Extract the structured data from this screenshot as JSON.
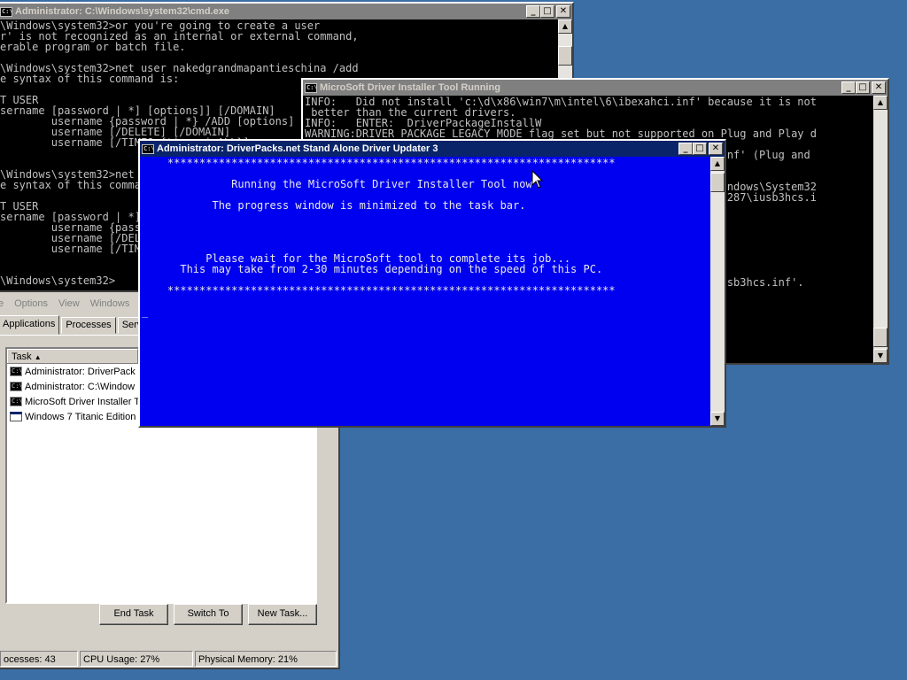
{
  "cmd_window": {
    "title": "Administrator: C:\\Windows\\system32\\cmd.exe",
    "lines": [
      "\\Windows\\system32>or you're going to create a user",
      "r' is not recognized as an internal or external command,",
      "erable program or batch file.",
      "",
      "\\Windows\\system32>net user nakedgrandmapantieschina /add",
      "e syntax of this command is:",
      "",
      "T USER",
      "sername [password | *] [options]] [/DOMAIN]",
      "        username {password | *} /ADD [options] [/DOMAIN]",
      "        username [/DELETE] [/DOMAIN]",
      "        username [/TIMES:{times | ALL}]",
      "",
      "",
      "\\Windows\\system32>net user",
      "e syntax of this command is:",
      "",
      "T USER",
      "sername [password | *] [options]] [/DOMAIN]",
      "        username {password | *} /ADD [options] [/DOMAIN]",
      "        username [/DELETE] [/DOMAIN]",
      "        username [/TIMES:{times | ALL}]",
      "",
      "",
      "\\Windows\\system32>"
    ]
  },
  "installer_window": {
    "title": "MicroSoft Driver Installer Tool Running",
    "lines": [
      "INFO:   Did not install 'c:\\d\\x86\\win7\\m\\intel\\6\\ibexahci.inf' because it is not",
      " better than the current drivers.",
      "INFO:   ENTER:  DriverPackageInstallW",
      "WARNING:DRIVER_PACKAGE_LEGACY_MODE flag set but not supported on Plug and Play d",
      "                                                            ..",
      "                                                            3hcs.inf' (Plug and",
      "",
      "                                                            ..",
      "                                                            \"C:\\Windows\\System32",
      "                                                            77eb90287\\iusb3hcs.i",
      "",
      "",
      "",
      "",
      "",
      "",
      "",
      "                                                            l\\4\\iusb3hcs.inf'."
    ]
  },
  "driverpacks_window": {
    "title": "Administrator:  DriverPacks.net Stand Alone Driver Updater 3",
    "lines": [
      "    **********************************************************************",
      "",
      "              Running the MicroSoft Driver Installer Tool now",
      "",
      "           The progress window is minimized to the task bar.",
      "",
      "",
      "",
      "",
      "          Please wait for the MicroSoft tool to complete its job...",
      "      This may take from 2-30 minutes depending on the speed of this PC.",
      "",
      "    **********************************************************************",
      "",
      "_"
    ]
  },
  "task_manager": {
    "menu": [
      "e",
      "Options",
      "View",
      "Windows"
    ],
    "tabs": [
      "Applications",
      "Processes",
      "Servic"
    ],
    "column_header": "Task",
    "tasks": [
      {
        "icon": "cmd-icon",
        "label": "Administrator:  DriverPack"
      },
      {
        "icon": "cmd-icon",
        "label": "Administrator: C:\\Window"
      },
      {
        "icon": "cmd-icon",
        "label": "MicroSoft Driver Installer T"
      },
      {
        "icon": "app-window-icon",
        "label": "Windows 7 Titanic Edition"
      }
    ],
    "buttons": {
      "end_task": "End Task",
      "switch_to": "Switch To",
      "new_task": "New Task..."
    },
    "status": {
      "processes": "ocesses: 43",
      "cpu": "CPU Usage: 27%",
      "memory": "Physical Memory: 21%"
    }
  },
  "colors": {
    "desktop": "#3a6ea5",
    "active_title": "#0a246a",
    "inactive_title": "#808080",
    "blue_console": "#0000f0"
  }
}
